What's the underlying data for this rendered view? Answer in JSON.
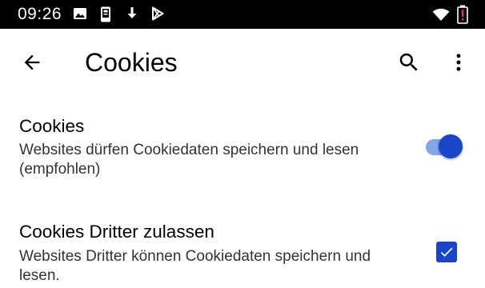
{
  "status_bar": {
    "time": "09:26",
    "icons": [
      "image-icon",
      "phone-icon",
      "download-icon",
      "play-store-icon",
      "wifi-icon",
      "battery-alert-icon"
    ],
    "battery_alert_color": "#e53935"
  },
  "app_bar": {
    "title": "Cookies",
    "back_icon": "arrow-back-icon",
    "search_icon": "search-icon",
    "more_icon": "more-vert-icon"
  },
  "settings": [
    {
      "title": "Cookies",
      "summary": "Websites dürfen Cookiedaten speichern und lesen (empfohlen)",
      "control": "toggle",
      "checked": true
    },
    {
      "title": "Cookies Dritter zulassen",
      "summary": "Websites Dritter können Cookiedaten speichern und lesen.",
      "control": "checkbox",
      "checked": true
    }
  ],
  "colors": {
    "accent": "#1a45c8",
    "toggle_track": "#82a6e8"
  }
}
